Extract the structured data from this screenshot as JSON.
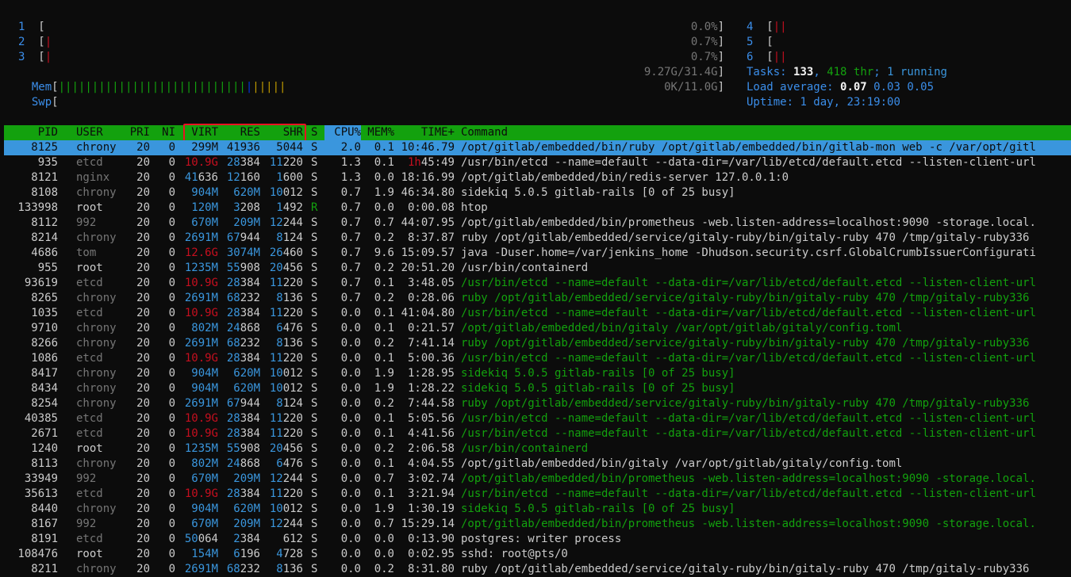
{
  "meters": {
    "cpus_left": [
      {
        "num": "1",
        "bar": [],
        "pct": "0.0%"
      },
      {
        "num": "2",
        "bar": [
          "red"
        ],
        "pct": "0.7%"
      },
      {
        "num": "3",
        "bar": [
          "red"
        ],
        "pct": "0.7%"
      }
    ],
    "cpus_right": [
      {
        "num": "4",
        "bar": [
          "red",
          "red"
        ]
      },
      {
        "num": "5",
        "bar": []
      },
      {
        "num": "6",
        "bar": [
          "red",
          "red"
        ]
      }
    ],
    "mem": {
      "label": "Mem",
      "green": 28,
      "blue": 1,
      "yellow": 5,
      "value": "9.27G/31.4G"
    },
    "swp": {
      "label": "Swp",
      "value": "0K/11.0G"
    },
    "tasks": {
      "label": "Tasks:",
      "count": "133",
      "sep1": ",",
      "threads": "418 thr",
      "sep2": ";",
      "running": "1 running"
    },
    "load": {
      "label": "Load average:",
      "l1": "0.07",
      "l5": "0.03",
      "l15": "0.05"
    },
    "uptime": {
      "label": "Uptime:",
      "value": "1 day, 23:19:00"
    }
  },
  "columns": {
    "pid": "PID",
    "user": "USER",
    "pri": "PRI",
    "ni": "NI",
    "virt": "VIRT",
    "res": "RES",
    "shr": "SHR",
    "s": "S",
    "cpu": "CPU%",
    "mem": "MEM%",
    "time": "TIME+",
    "command": "Command"
  },
  "processes": [
    {
      "pid": "8125",
      "user": "chrony",
      "pri": "20",
      "ni": "0",
      "virt": "299M",
      "res": "41936",
      "shr": "5044",
      "s": "S",
      "cpu": "2.0",
      "mem": "0.1",
      "time": "10:46.79",
      "cmd": "/opt/gitlab/embedded/bin/ruby /opt/gitlab/embedded/bin/gitlab-mon web -c /var/opt/gitl",
      "thread": false,
      "selected": true
    },
    {
      "pid": "935",
      "user": "etcd",
      "pri": "20",
      "ni": "0",
      "virt": "10.9G",
      "res": "28384",
      "shr": "11220",
      "s": "S",
      "cpu": "1.3",
      "mem": "0.1",
      "time": "1h45:49",
      "cmd": "/usr/bin/etcd --name=default --data-dir=/var/lib/etcd/default.etcd --listen-client-url",
      "thread": false
    },
    {
      "pid": "8121",
      "user": "nginx",
      "pri": "20",
      "ni": "0",
      "virt": "41636",
      "res": "12160",
      "shr": "1600",
      "s": "S",
      "cpu": "1.3",
      "mem": "0.0",
      "time": "18:16.99",
      "cmd": "/opt/gitlab/embedded/bin/redis-server 127.0.0.1:0",
      "thread": false
    },
    {
      "pid": "8108",
      "user": "chrony",
      "pri": "20",
      "ni": "0",
      "virt": "904M",
      "res": "620M",
      "shr": "10012",
      "s": "S",
      "cpu": "0.7",
      "mem": "1.9",
      "time": "46:34.80",
      "cmd": "sidekiq 5.0.5 gitlab-rails [0 of 25 busy]",
      "thread": false
    },
    {
      "pid": "133998",
      "user": "root",
      "pri": "20",
      "ni": "0",
      "virt": "120M",
      "res": "3208",
      "shr": "1492",
      "s": "R",
      "cpu": "0.7",
      "mem": "0.0",
      "time": "0:00.08",
      "cmd": "htop",
      "thread": false
    },
    {
      "pid": "8112",
      "user": "992",
      "pri": "20",
      "ni": "0",
      "virt": "670M",
      "res": "209M",
      "shr": "12244",
      "s": "S",
      "cpu": "0.7",
      "mem": "0.7",
      "time": "44:07.95",
      "cmd": "/opt/gitlab/embedded/bin/prometheus -web.listen-address=localhost:9090 -storage.local.",
      "thread": false
    },
    {
      "pid": "8214",
      "user": "chrony",
      "pri": "20",
      "ni": "0",
      "virt": "2691M",
      "res": "67944",
      "shr": "8124",
      "s": "S",
      "cpu": "0.7",
      "mem": "0.2",
      "time": "8:37.87",
      "cmd": "ruby /opt/gitlab/embedded/service/gitaly-ruby/bin/gitaly-ruby 470 /tmp/gitaly-ruby336",
      "thread": false
    },
    {
      "pid": "4686",
      "user": "tom",
      "pri": "20",
      "ni": "0",
      "virt": "12.6G",
      "res": "3074M",
      "shr": "26460",
      "s": "S",
      "cpu": "0.7",
      "mem": "9.6",
      "time": "15:09.57",
      "cmd": "java -Duser.home=/var/jenkins_home -Dhudson.security.csrf.GlobalCrumbIssuerConfigurati",
      "thread": false
    },
    {
      "pid": "955",
      "user": "root",
      "pri": "20",
      "ni": "0",
      "virt": "1235M",
      "res": "55908",
      "shr": "20456",
      "s": "S",
      "cpu": "0.7",
      "mem": "0.2",
      "time": "20:51.20",
      "cmd": "/usr/bin/containerd",
      "thread": false
    },
    {
      "pid": "93619",
      "user": "etcd",
      "pri": "20",
      "ni": "0",
      "virt": "10.9G",
      "res": "28384",
      "shr": "11220",
      "s": "S",
      "cpu": "0.7",
      "mem": "0.1",
      "time": "3:48.05",
      "cmd": "/usr/bin/etcd --name=default --data-dir=/var/lib/etcd/default.etcd --listen-client-url",
      "thread": true
    },
    {
      "pid": "8265",
      "user": "chrony",
      "pri": "20",
      "ni": "0",
      "virt": "2691M",
      "res": "68232",
      "shr": "8136",
      "s": "S",
      "cpu": "0.7",
      "mem": "0.2",
      "time": "0:28.06",
      "cmd": "ruby /opt/gitlab/embedded/service/gitaly-ruby/bin/gitaly-ruby 470 /tmp/gitaly-ruby336",
      "thread": true
    },
    {
      "pid": "1035",
      "user": "etcd",
      "pri": "20",
      "ni": "0",
      "virt": "10.9G",
      "res": "28384",
      "shr": "11220",
      "s": "S",
      "cpu": "0.0",
      "mem": "0.1",
      "time": "41:04.80",
      "cmd": "/usr/bin/etcd --name=default --data-dir=/var/lib/etcd/default.etcd --listen-client-url",
      "thread": true
    },
    {
      "pid": "9710",
      "user": "chrony",
      "pri": "20",
      "ni": "0",
      "virt": "802M",
      "res": "24868",
      "shr": "6476",
      "s": "S",
      "cpu": "0.0",
      "mem": "0.1",
      "time": "0:21.57",
      "cmd": "/opt/gitlab/embedded/bin/gitaly /var/opt/gitlab/gitaly/config.toml",
      "thread": true
    },
    {
      "pid": "8266",
      "user": "chrony",
      "pri": "20",
      "ni": "0",
      "virt": "2691M",
      "res": "68232",
      "shr": "8136",
      "s": "S",
      "cpu": "0.0",
      "mem": "0.2",
      "time": "7:41.14",
      "cmd": "ruby /opt/gitlab/embedded/service/gitaly-ruby/bin/gitaly-ruby 470 /tmp/gitaly-ruby336",
      "thread": true
    },
    {
      "pid": "1086",
      "user": "etcd",
      "pri": "20",
      "ni": "0",
      "virt": "10.9G",
      "res": "28384",
      "shr": "11220",
      "s": "S",
      "cpu": "0.0",
      "mem": "0.1",
      "time": "5:00.36",
      "cmd": "/usr/bin/etcd --name=default --data-dir=/var/lib/etcd/default.etcd --listen-client-url",
      "thread": true
    },
    {
      "pid": "8417",
      "user": "chrony",
      "pri": "20",
      "ni": "0",
      "virt": "904M",
      "res": "620M",
      "shr": "10012",
      "s": "S",
      "cpu": "0.0",
      "mem": "1.9",
      "time": "1:28.95",
      "cmd": "sidekiq 5.0.5 gitlab-rails [0 of 25 busy]",
      "thread": true
    },
    {
      "pid": "8434",
      "user": "chrony",
      "pri": "20",
      "ni": "0",
      "virt": "904M",
      "res": "620M",
      "shr": "10012",
      "s": "S",
      "cpu": "0.0",
      "mem": "1.9",
      "time": "1:28.22",
      "cmd": "sidekiq 5.0.5 gitlab-rails [0 of 25 busy]",
      "thread": true
    },
    {
      "pid": "8254",
      "user": "chrony",
      "pri": "20",
      "ni": "0",
      "virt": "2691M",
      "res": "67944",
      "shr": "8124",
      "s": "S",
      "cpu": "0.0",
      "mem": "0.2",
      "time": "7:44.58",
      "cmd": "ruby /opt/gitlab/embedded/service/gitaly-ruby/bin/gitaly-ruby 470 /tmp/gitaly-ruby336",
      "thread": true
    },
    {
      "pid": "40385",
      "user": "etcd",
      "pri": "20",
      "ni": "0",
      "virt": "10.9G",
      "res": "28384",
      "shr": "11220",
      "s": "S",
      "cpu": "0.0",
      "mem": "0.1",
      "time": "5:05.56",
      "cmd": "/usr/bin/etcd --name=default --data-dir=/var/lib/etcd/default.etcd --listen-client-url",
      "thread": true
    },
    {
      "pid": "2671",
      "user": "etcd",
      "pri": "20",
      "ni": "0",
      "virt": "10.9G",
      "res": "28384",
      "shr": "11220",
      "s": "S",
      "cpu": "0.0",
      "mem": "0.1",
      "time": "4:41.56",
      "cmd": "/usr/bin/etcd --name=default --data-dir=/var/lib/etcd/default.etcd --listen-client-url",
      "thread": true
    },
    {
      "pid": "1240",
      "user": "root",
      "pri": "20",
      "ni": "0",
      "virt": "1235M",
      "res": "55908",
      "shr": "20456",
      "s": "S",
      "cpu": "0.0",
      "mem": "0.2",
      "time": "2:06.58",
      "cmd": "/usr/bin/containerd",
      "thread": true
    },
    {
      "pid": "8113",
      "user": "chrony",
      "pri": "20",
      "ni": "0",
      "virt": "802M",
      "res": "24868",
      "shr": "6476",
      "s": "S",
      "cpu": "0.0",
      "mem": "0.1",
      "time": "4:04.55",
      "cmd": "/opt/gitlab/embedded/bin/gitaly /var/opt/gitlab/gitaly/config.toml",
      "thread": false
    },
    {
      "pid": "33949",
      "user": "992",
      "pri": "20",
      "ni": "0",
      "virt": "670M",
      "res": "209M",
      "shr": "12244",
      "s": "S",
      "cpu": "0.0",
      "mem": "0.7",
      "time": "3:02.74",
      "cmd": "/opt/gitlab/embedded/bin/prometheus -web.listen-address=localhost:9090 -storage.local.",
      "thread": true
    },
    {
      "pid": "35613",
      "user": "etcd",
      "pri": "20",
      "ni": "0",
      "virt": "10.9G",
      "res": "28384",
      "shr": "11220",
      "s": "S",
      "cpu": "0.0",
      "mem": "0.1",
      "time": "3:21.94",
      "cmd": "/usr/bin/etcd --name=default --data-dir=/var/lib/etcd/default.etcd --listen-client-url",
      "thread": true
    },
    {
      "pid": "8440",
      "user": "chrony",
      "pri": "20",
      "ni": "0",
      "virt": "904M",
      "res": "620M",
      "shr": "10012",
      "s": "S",
      "cpu": "0.0",
      "mem": "1.9",
      "time": "1:30.19",
      "cmd": "sidekiq 5.0.5 gitlab-rails [0 of 25 busy]",
      "thread": true
    },
    {
      "pid": "8167",
      "user": "992",
      "pri": "20",
      "ni": "0",
      "virt": "670M",
      "res": "209M",
      "shr": "12244",
      "s": "S",
      "cpu": "0.0",
      "mem": "0.7",
      "time": "15:29.14",
      "cmd": "/opt/gitlab/embedded/bin/prometheus -web.listen-address=localhost:9090 -storage.local.",
      "thread": true
    },
    {
      "pid": "8191",
      "user": "etcd",
      "pri": "20",
      "ni": "0",
      "virt": "50064",
      "res": "2384",
      "shr": "612",
      "s": "S",
      "cpu": "0.0",
      "mem": "0.0",
      "time": "0:13.90",
      "cmd": "postgres: writer process",
      "thread": false
    },
    {
      "pid": "108476",
      "user": "root",
      "pri": "20",
      "ni": "0",
      "virt": "154M",
      "res": "6196",
      "shr": "4728",
      "s": "S",
      "cpu": "0.0",
      "mem": "0.0",
      "time": "0:02.95",
      "cmd": "sshd: root@pts/0",
      "thread": false
    },
    {
      "pid": "8211",
      "user": "chrony",
      "pri": "20",
      "ni": "0",
      "virt": "2691M",
      "res": "68232",
      "shr": "8136",
      "s": "S",
      "cpu": "0.0",
      "mem": "0.2",
      "time": "8:31.80",
      "cmd": "ruby /opt/gitlab/embedded/service/gitaly-ruby/bin/gitaly-ruby 470 /tmp/gitaly-ruby336",
      "thread": false
    }
  ],
  "highlight": {
    "columns": "VIRT RES SHR",
    "color": "#e81123"
  }
}
